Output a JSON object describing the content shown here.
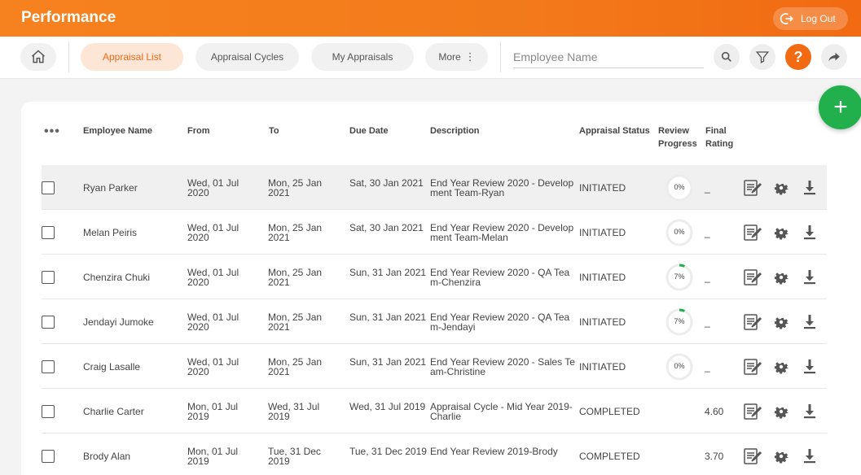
{
  "header": {
    "title": "Performance",
    "logout_label": "Log Out"
  },
  "nav": {
    "tabs": [
      {
        "label": "Appraisal List",
        "active": true
      },
      {
        "label": "Appraisal Cycles",
        "active": false
      },
      {
        "label": "My Appraisals",
        "active": false
      },
      {
        "label": "More",
        "active": false
      }
    ],
    "search_placeholder": "Employee Name",
    "help_label": "?"
  },
  "table": {
    "columns": [
      "Employee Name",
      "From",
      "To",
      "Due Date",
      "Description",
      "Appraisal Status",
      "Review Progress",
      "Final Rating"
    ],
    "rows": [
      {
        "name": "Ryan Parker",
        "from": "Wed, 01 Jul 2020",
        "to": "Mon, 25 Jan 2021",
        "due": "Sat, 30 Jan 2021",
        "description": "End Year Review 2020 - Development Team-Ryan",
        "status": "INITIATED",
        "progress": 0,
        "progress_label": "0%",
        "rating": "_"
      },
      {
        "name": "Melan Peiris",
        "from": "Wed, 01 Jul 2020",
        "to": "Mon, 25 Jan 2021",
        "due": "Sat, 30 Jan 2021",
        "description": "End Year Review 2020 - Development Team-Melan",
        "status": "INITIATED",
        "progress": 0,
        "progress_label": "0%",
        "rating": "_"
      },
      {
        "name": "Chenzira Chuki",
        "from": "Wed, 01 Jul 2020",
        "to": "Mon, 25 Jan 2021",
        "due": "Sun, 31 Jan 2021",
        "description": "End Year Review 2020 - QA Team-Chenzira",
        "status": "INITIATED",
        "progress": 7,
        "progress_label": "7%",
        "rating": "_"
      },
      {
        "name": "Jendayi Jumoke",
        "from": "Wed, 01 Jul 2020",
        "to": "Mon, 25 Jan 2021",
        "due": "Sun, 31 Jan 2021",
        "description": "End Year Review 2020 - QA Team-Jendayi",
        "status": "INITIATED",
        "progress": 7,
        "progress_label": "7%",
        "rating": "_"
      },
      {
        "name": "Craig Lasalle",
        "from": "Wed, 01 Jul 2020",
        "to": "Mon, 25 Jan 2021",
        "due": "Sun, 31 Jan 2021",
        "description": "End Year Review 2020 - Sales Team-Christine",
        "status": "INITIATED",
        "progress": 0,
        "progress_label": "0%",
        "rating": "_"
      },
      {
        "name": "Charlie Carter",
        "from": "Mon, 01 Jul 2019",
        "to": "Wed, 31 Jul 2019",
        "due": "Wed, 31 Jul 2019",
        "description": "Appraisal Cycle - Mid Year 2019-Charlie",
        "status": "COMPLETED",
        "progress": null,
        "progress_label": "",
        "rating": "4.60"
      },
      {
        "name": "Brody Alan",
        "from": "Mon, 01 Jul 2019",
        "to": "Tue, 31 Dec 2019",
        "due": "Tue, 31 Dec 2019",
        "description": "End Year Review 2019-Brody",
        "status": "COMPLETED",
        "progress": null,
        "progress_label": "",
        "rating": "3.70"
      }
    ]
  },
  "colors": {
    "brand": "#f26a12",
    "progress": "#21b04b",
    "fab": "#21b04b"
  },
  "icons": [
    "logout-icon",
    "home-icon",
    "search-icon",
    "filter-icon",
    "help-icon",
    "share-icon",
    "add-icon",
    "edit-icon",
    "gear-icon",
    "download-icon"
  ]
}
